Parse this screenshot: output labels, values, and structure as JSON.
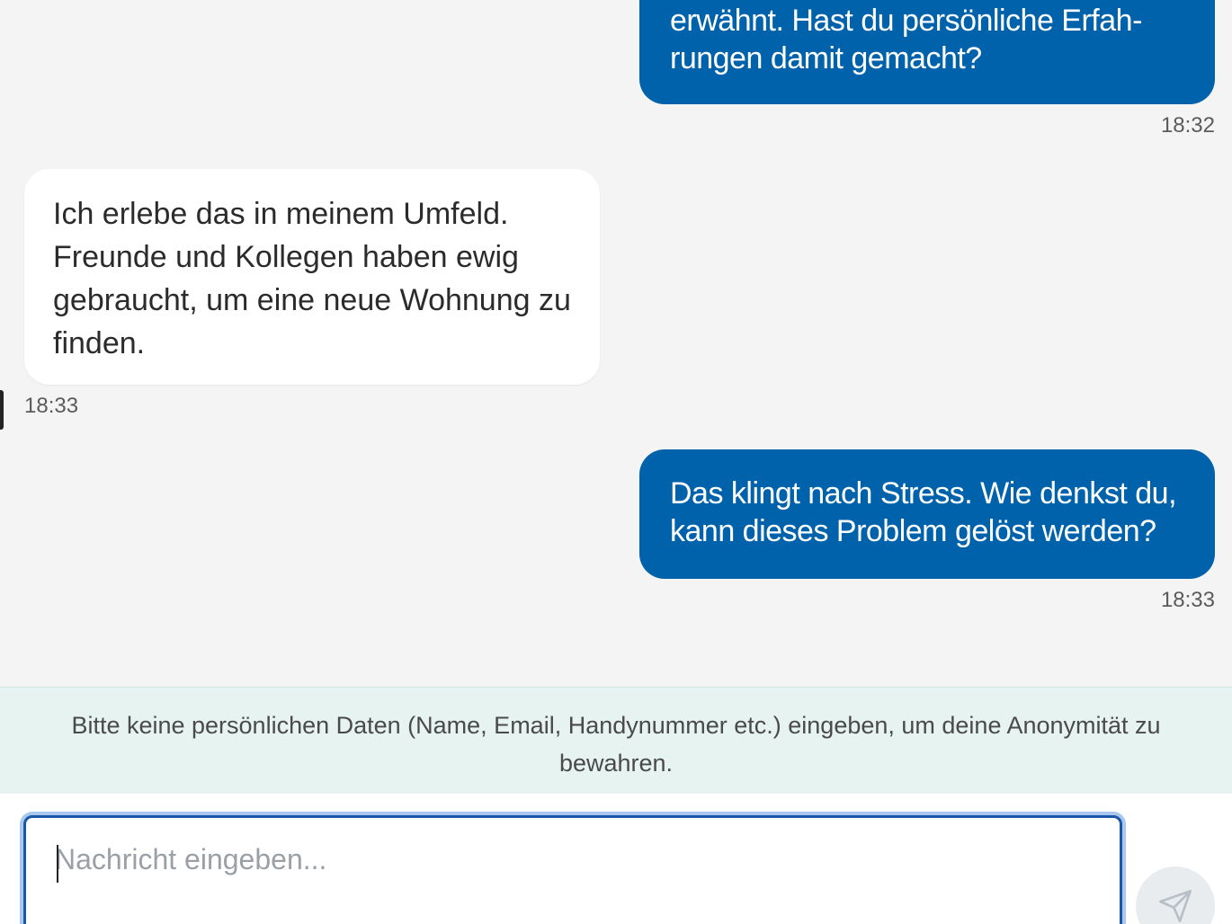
{
  "messages": [
    {
      "direction": "outgoing",
      "lines": [
        "erwähnt. Hast du persönliche Erfah-",
        "rungen damit gemacht?"
      ],
      "time": "18:32"
    },
    {
      "direction": "incoming",
      "lines": [
        "Ich erlebe das in meinem Umfeld.",
        "Freunde und Kollegen haben ewig",
        "gebraucht, um eine neue Wohnung zu",
        "finden."
      ],
      "time": "18:33"
    },
    {
      "direction": "outgoing",
      "lines": [
        "Das klingt nach Stress. Wie denkst du,",
        "kann dieses Problem gelöst werden?"
      ],
      "time": "18:33"
    }
  ],
  "notice": {
    "line1": "Bitte keine persönlichen Daten (Name, Email, Handynummer etc.) eingeben, um deine Anonymität zu",
    "line2": "bewahren."
  },
  "composer": {
    "placeholder": "Nachricht eingeben...",
    "value": ""
  },
  "send_button": {
    "icon": "send-icon"
  },
  "colors": {
    "outgoing_bubble": "#0062ab",
    "incoming_bubble": "#ffffff",
    "notice_bg": "#e6f3f1",
    "input_focus": "#1a57a6"
  }
}
